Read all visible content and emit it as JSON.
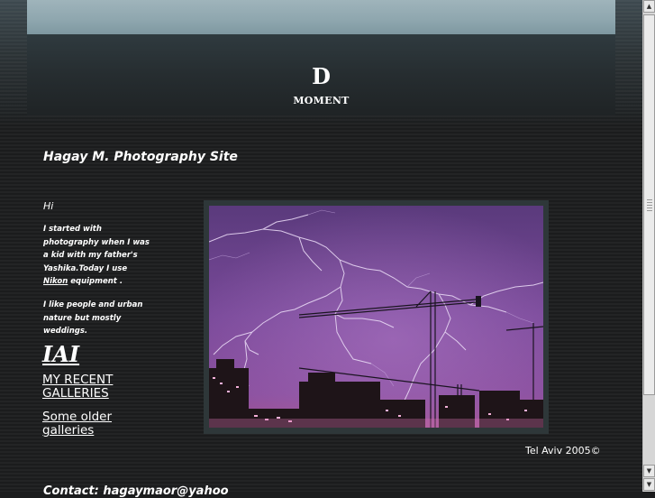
{
  "header": {
    "logo_letter": "D",
    "logo_sub": "MOMENT"
  },
  "site_title": "Hagay M. Photography Site",
  "intro": {
    "greeting": "Hi",
    "text_a": "I started with photography when I was a kid with my father's Yashika.Today I use",
    "nikon_link": "Nikon",
    "text_b": " equipment .",
    "text_c": "I like people and urban nature but mostly weddings."
  },
  "nav": {
    "iai": "IAI",
    "recent": "MY RECENT GALLERIES",
    "older": "Some older galleries"
  },
  "footer": {
    "location": "Tel Aviv 2005©",
    "cut_text": "Contact: hagaymaor@yahoo"
  },
  "colors": {
    "background": "#1b1c1d",
    "banner": "#9fb4bb",
    "frame": "#2e3739",
    "photo_sky": "#6b3f8a"
  },
  "icons": {
    "scroll_up": "arrow-up-icon",
    "scroll_down": "arrow-down-icon"
  }
}
